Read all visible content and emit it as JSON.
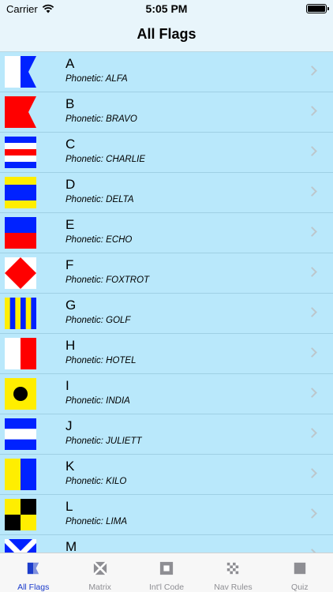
{
  "status": {
    "carrier": "Carrier",
    "time": "5:05 PM"
  },
  "nav": {
    "title": "All Flags"
  },
  "flags": [
    {
      "letter": "A",
      "phonetic": "Phonetic: ALFA",
      "flag_icon": "flag-alfa"
    },
    {
      "letter": "B",
      "phonetic": "Phonetic: BRAVO",
      "flag_icon": "flag-bravo"
    },
    {
      "letter": "C",
      "phonetic": "Phonetic: CHARLIE",
      "flag_icon": "flag-charlie"
    },
    {
      "letter": "D",
      "phonetic": "Phonetic: DELTA",
      "flag_icon": "flag-delta"
    },
    {
      "letter": "E",
      "phonetic": "Phonetic: ECHO",
      "flag_icon": "flag-echo"
    },
    {
      "letter": "F",
      "phonetic": "Phonetic: FOXTROT",
      "flag_icon": "flag-foxtrot"
    },
    {
      "letter": "G",
      "phonetic": "Phonetic: GOLF",
      "flag_icon": "flag-golf"
    },
    {
      "letter": "H",
      "phonetic": "Phonetic: HOTEL",
      "flag_icon": "flag-hotel"
    },
    {
      "letter": "I",
      "phonetic": "Phonetic: INDIA",
      "flag_icon": "flag-india"
    },
    {
      "letter": "J",
      "phonetic": "Phonetic: JULIETT",
      "flag_icon": "flag-juliett"
    },
    {
      "letter": "K",
      "phonetic": "Phonetic: KILO",
      "flag_icon": "flag-kilo"
    },
    {
      "letter": "L",
      "phonetic": "Phonetic: LIMA",
      "flag_icon": "flag-lima"
    },
    {
      "letter": "M",
      "phonetic": "",
      "flag_icon": "flag-mike"
    }
  ],
  "tabs": [
    {
      "label": "All Flags",
      "icon": "all-flags-icon",
      "active": true
    },
    {
      "label": "Matrix",
      "icon": "matrix-icon",
      "active": false
    },
    {
      "label": "Int'l Code",
      "icon": "intl-code-icon",
      "active": false
    },
    {
      "label": "Nav Rules",
      "icon": "nav-rules-icon",
      "active": false
    },
    {
      "label": "Quiz",
      "icon": "quiz-icon",
      "active": false
    }
  ],
  "colors": {
    "bar_background": "#e8f5fb",
    "list_background": "#b9e8fb",
    "flag_red": "#ff0000",
    "flag_blue": "#0022ff",
    "flag_yellow": "#ffee00",
    "tab_active": "#1b3bcb",
    "tab_inactive": "#8e8e93"
  }
}
